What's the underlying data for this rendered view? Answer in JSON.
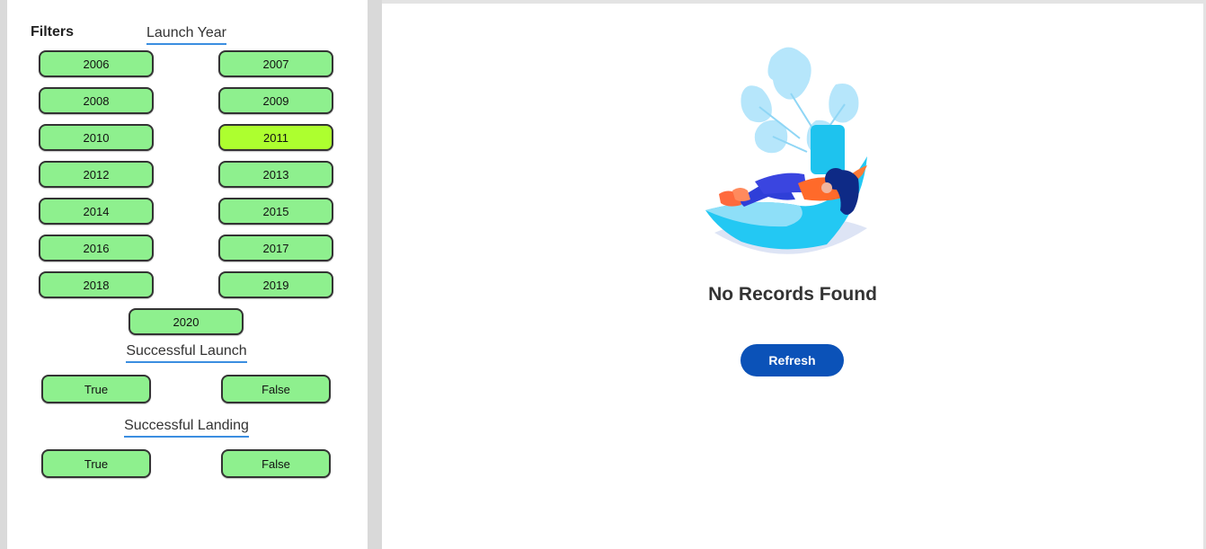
{
  "filters": {
    "title": "Filters",
    "launch_year": {
      "heading": "Launch Year",
      "years": [
        "2006",
        "2007",
        "2008",
        "2009",
        "2010",
        "2011",
        "2012",
        "2013",
        "2014",
        "2015",
        "2016",
        "2017",
        "2018",
        "2019",
        "2020"
      ],
      "selected": "2011"
    },
    "successful_launch": {
      "heading": "Successful Launch",
      "true_label": "True",
      "false_label": "False"
    },
    "successful_landing": {
      "heading": "Successful Landing",
      "true_label": "True",
      "false_label": "False"
    }
  },
  "colors": {
    "pill_default": "#8ef08e",
    "pill_selected": "#adff2f",
    "refresh_button": "#0b52b8",
    "heading_underline": "#3b8ee0"
  },
  "empty_state": {
    "title": "No Records Found",
    "refresh_label": "Refresh",
    "illustration_icon": "person-relaxing-with-plant-illustration"
  }
}
